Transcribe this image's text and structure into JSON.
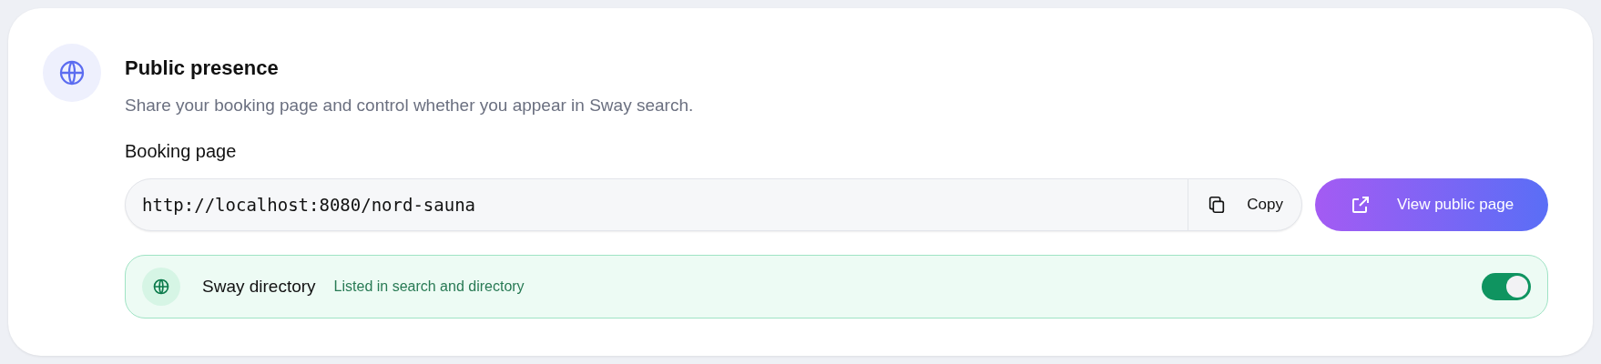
{
  "section": {
    "title": "Public presence",
    "description": "Share your booking page and control whether you appear in Sway search."
  },
  "booking_page": {
    "label": "Booking page",
    "url": "http://localhost:8080/nord-sauna",
    "copy_button": "Copy",
    "view_button": "View public page"
  },
  "directory": {
    "title": "Sway directory",
    "status": "Listed in search and directory",
    "on": true
  }
}
